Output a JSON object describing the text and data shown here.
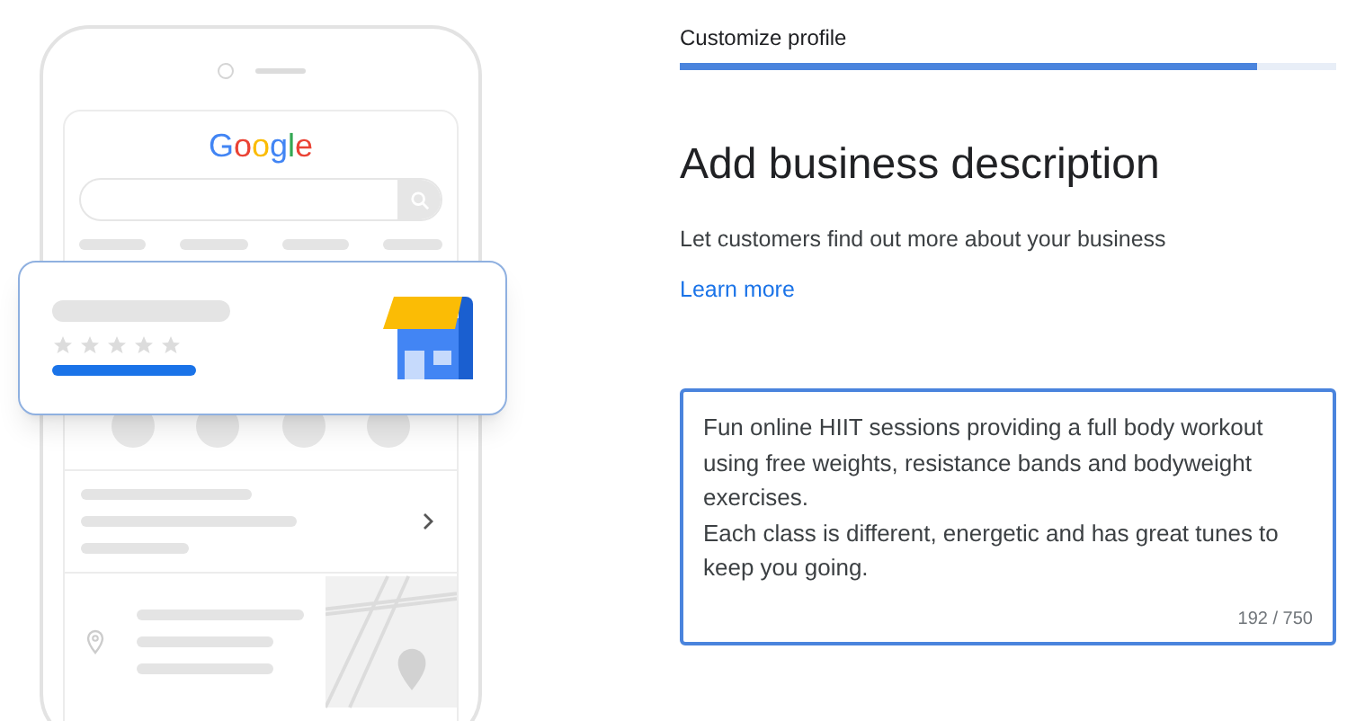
{
  "illustration": {
    "logo": "Google"
  },
  "step": {
    "label": "Customize profile",
    "level": 0.88
  },
  "heading": "Add business description",
  "subtitle": "Let customers find out more about your business",
  "link": "Learn more",
  "description": {
    "value": "Fun online HIIT sessions providing a full body workout using free weights, resistance bands and bodyweight exercises.\nEach class is different, energetic and has great tunes to keep you going.",
    "counter": "192 / 750"
  }
}
